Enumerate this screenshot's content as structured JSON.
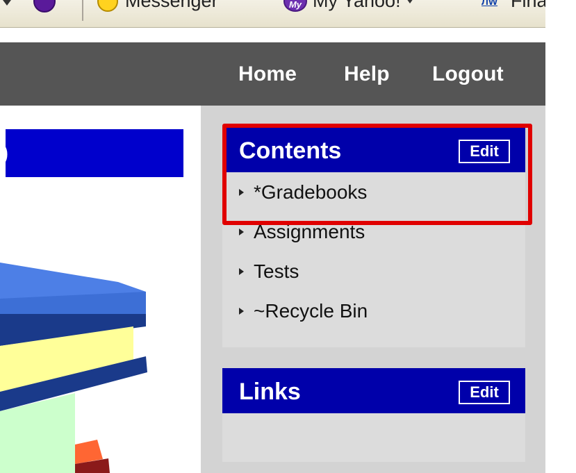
{
  "browser_toolbar": {
    "items": [
      {
        "label": "Messenger",
        "icon": "messenger-smiley-icon"
      },
      {
        "label": "My Yahoo!",
        "icon": "my-yahoo-icon"
      },
      {
        "label": "Finan",
        "icon": "finance-icon"
      }
    ]
  },
  "header": {
    "nav": {
      "home": "Home",
      "help": "Help",
      "logout": "Logout"
    }
  },
  "main": {
    "title_fragment": ")"
  },
  "contents_panel": {
    "title": "Contents",
    "edit_label": "Edit",
    "items": [
      {
        "label": "*Gradebooks"
      },
      {
        "label": "Assignments"
      },
      {
        "label": "Tests"
      },
      {
        "label": "~Recycle Bin"
      }
    ]
  },
  "links_panel": {
    "title": "Links",
    "edit_label": "Edit"
  },
  "colors": {
    "header_bg": "#555555",
    "panel_header_bg": "#0000aa",
    "highlight_border": "#e00000",
    "sidebar_bg": "#d3d3d3"
  }
}
